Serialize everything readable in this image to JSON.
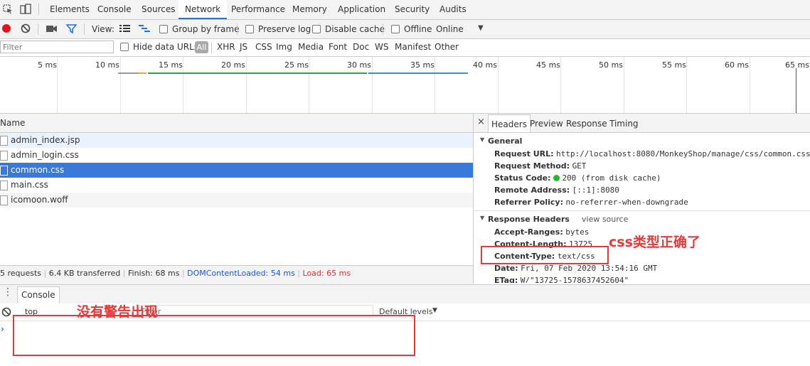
{
  "tabs": [
    "Elements",
    "Console",
    "Sources",
    "Network",
    "Performance",
    "Memory",
    "Application",
    "Security",
    "Audits"
  ],
  "toolbar": {
    "view_label": "View:",
    "group_by_frame": "Group by frame",
    "preserve_log": "Preserve log",
    "disable_cache": "Disable cache",
    "offline": "Offline",
    "online": "Online"
  },
  "filter": {
    "placeholder": "Filter",
    "hide_data_urls": "Hide data URLs",
    "types": [
      "All",
      "XHR",
      "JS",
      "CSS",
      "Img",
      "Media",
      "Font",
      "Doc",
      "WS",
      "Manifest",
      "Other"
    ]
  },
  "timeline": {
    "ticks": [
      "5 ms",
      "10 ms",
      "15 ms",
      "20 ms",
      "25 ms",
      "30 ms",
      "35 ms",
      "40 ms",
      "45 ms",
      "50 ms",
      "55 ms",
      "60 ms",
      "65 ms"
    ]
  },
  "list": {
    "header": "Name",
    "rows": [
      "admin_index.jsp",
      "admin_login.css",
      "common.css",
      "main.css",
      "icomoon.woff"
    ],
    "selected_index": 2
  },
  "status": {
    "requests": "5 requests",
    "transferred": "6.4 KB transferred",
    "finish": "Finish: 68 ms",
    "dom": "DOMContentLoaded: 54 ms",
    "load": "Load: 65 ms"
  },
  "detail": {
    "tabs": [
      "Headers",
      "Preview",
      "Response",
      "Timing"
    ],
    "general_title": "General",
    "general": [
      {
        "k": "Request URL:",
        "v": "http://localhost:8080/MonkeyShop/manage/css/common.css"
      },
      {
        "k": "Request Method:",
        "v": "GET"
      },
      {
        "k": "Status Code:",
        "v": "200  (from disk cache)"
      },
      {
        "k": "Remote Address:",
        "v": "[::1]:8080"
      },
      {
        "k": "Referrer Policy:",
        "v": "no-referrer-when-downgrade"
      }
    ],
    "response_title": "Response Headers",
    "view_source": "view source",
    "response": [
      {
        "k": "Accept-Ranges:",
        "v": "bytes"
      },
      {
        "k": "Content-Length:",
        "v": "13725"
      },
      {
        "k": "Content-Type:",
        "v": "text/css"
      },
      {
        "k": "Date:",
        "v": "Fri, 07 Feb 2020 13:54:16 GMT"
      },
      {
        "k": "ETag:",
        "v": "W/\"13725-1578637452604\""
      }
    ]
  },
  "console": {
    "tab": "Console",
    "context": "top",
    "filter_placeholder": "Filter",
    "levels": "Default levels"
  },
  "annotations": {
    "css_ok": "css类型正确了",
    "no_warning": "没有警告出现"
  },
  "colors": {
    "accent": "#1a73e8",
    "selected_row": "#3879d9",
    "annotation": "#e23b3b",
    "status_ok": "#2cb52c"
  }
}
